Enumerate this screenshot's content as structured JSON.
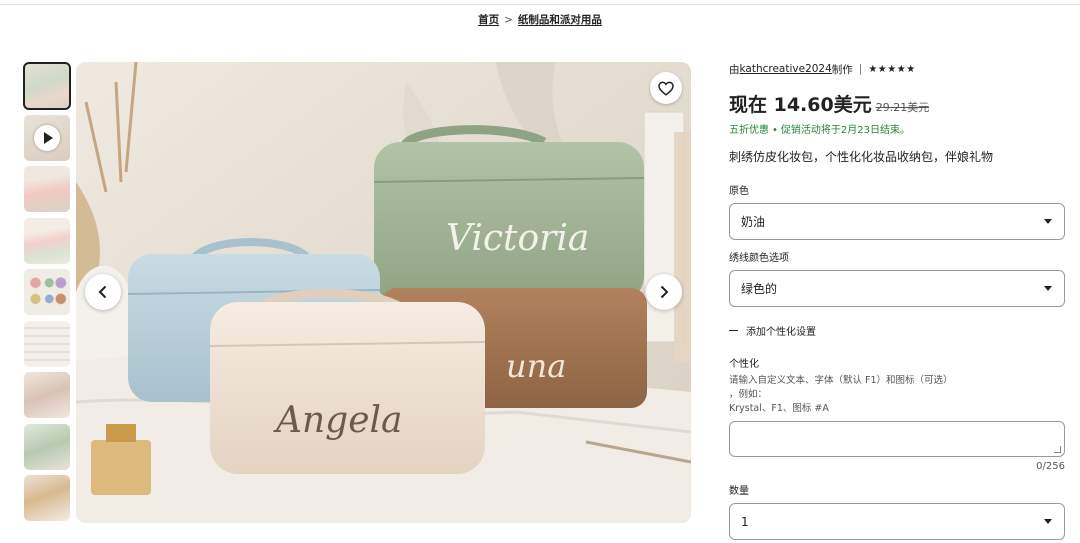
{
  "breadcrumb": {
    "home": "首页",
    "separator": ">",
    "category": "纸制品和派对用品"
  },
  "gallery": {
    "thumbnail_count": 9,
    "thumbnail_video_index": 1,
    "bag_names": [
      "Victoria",
      "Angela",
      "Luna"
    ],
    "icons": {
      "favorite": "heart-icon",
      "prev": "chevron-left-icon",
      "next": "chevron-right-icon",
      "video": "play-icon"
    }
  },
  "seller": {
    "prefix": "由",
    "name": "kathcreative2024",
    "suffix": "制作",
    "divider": "|",
    "stars": "★★★★★",
    "rating": 5
  },
  "price": {
    "current": "现在 14.60美元",
    "original": "29.21美元"
  },
  "sale": {
    "discount": "五折优惠",
    "dot": "•",
    "note": "促销活动将于2月23日结束。"
  },
  "product_title": "刺绣仿皮化妆包，个性化化妆品收纳包，伴娘礼物",
  "options": {
    "color": {
      "label": "原色",
      "value": "奶油"
    },
    "thread": {
      "label": "绣线颜色选项",
      "value": "绿色的"
    }
  },
  "personalization": {
    "toggle_label": "添加个性化设置",
    "heading": "个性化",
    "hint_line1": "请输入自定义文本、字体（默认 F1）和图标（可选）",
    "hint_line2": "，例如：",
    "hint_line3": "Krystal、F1、图标 #A",
    "value": "",
    "counter": "0/256"
  },
  "quantity": {
    "label": "数量",
    "value": "1"
  },
  "colors": {
    "sale_green": "#258635",
    "text": "#222222",
    "border": "#9a9a9a"
  }
}
